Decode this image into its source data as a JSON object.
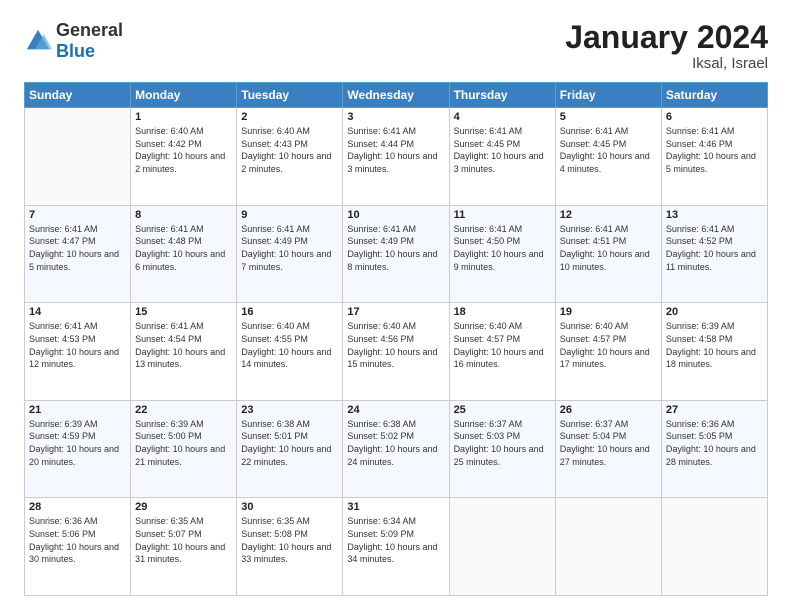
{
  "logo": {
    "general": "General",
    "blue": "Blue"
  },
  "header": {
    "month": "January 2024",
    "location": "Iksal, Israel"
  },
  "weekdays": [
    "Sunday",
    "Monday",
    "Tuesday",
    "Wednesday",
    "Thursday",
    "Friday",
    "Saturday"
  ],
  "weeks": [
    [
      {
        "day": "",
        "sunrise": "",
        "sunset": "",
        "daylight": ""
      },
      {
        "day": "1",
        "sunrise": "Sunrise: 6:40 AM",
        "sunset": "Sunset: 4:42 PM",
        "daylight": "Daylight: 10 hours and 2 minutes."
      },
      {
        "day": "2",
        "sunrise": "Sunrise: 6:40 AM",
        "sunset": "Sunset: 4:43 PM",
        "daylight": "Daylight: 10 hours and 2 minutes."
      },
      {
        "day": "3",
        "sunrise": "Sunrise: 6:41 AM",
        "sunset": "Sunset: 4:44 PM",
        "daylight": "Daylight: 10 hours and 3 minutes."
      },
      {
        "day": "4",
        "sunrise": "Sunrise: 6:41 AM",
        "sunset": "Sunset: 4:45 PM",
        "daylight": "Daylight: 10 hours and 3 minutes."
      },
      {
        "day": "5",
        "sunrise": "Sunrise: 6:41 AM",
        "sunset": "Sunset: 4:45 PM",
        "daylight": "Daylight: 10 hours and 4 minutes."
      },
      {
        "day": "6",
        "sunrise": "Sunrise: 6:41 AM",
        "sunset": "Sunset: 4:46 PM",
        "daylight": "Daylight: 10 hours and 5 minutes."
      }
    ],
    [
      {
        "day": "7",
        "sunrise": "Sunrise: 6:41 AM",
        "sunset": "Sunset: 4:47 PM",
        "daylight": "Daylight: 10 hours and 5 minutes."
      },
      {
        "day": "8",
        "sunrise": "Sunrise: 6:41 AM",
        "sunset": "Sunset: 4:48 PM",
        "daylight": "Daylight: 10 hours and 6 minutes."
      },
      {
        "day": "9",
        "sunrise": "Sunrise: 6:41 AM",
        "sunset": "Sunset: 4:49 PM",
        "daylight": "Daylight: 10 hours and 7 minutes."
      },
      {
        "day": "10",
        "sunrise": "Sunrise: 6:41 AM",
        "sunset": "Sunset: 4:49 PM",
        "daylight": "Daylight: 10 hours and 8 minutes."
      },
      {
        "day": "11",
        "sunrise": "Sunrise: 6:41 AM",
        "sunset": "Sunset: 4:50 PM",
        "daylight": "Daylight: 10 hours and 9 minutes."
      },
      {
        "day": "12",
        "sunrise": "Sunrise: 6:41 AM",
        "sunset": "Sunset: 4:51 PM",
        "daylight": "Daylight: 10 hours and 10 minutes."
      },
      {
        "day": "13",
        "sunrise": "Sunrise: 6:41 AM",
        "sunset": "Sunset: 4:52 PM",
        "daylight": "Daylight: 10 hours and 11 minutes."
      }
    ],
    [
      {
        "day": "14",
        "sunrise": "Sunrise: 6:41 AM",
        "sunset": "Sunset: 4:53 PM",
        "daylight": "Daylight: 10 hours and 12 minutes."
      },
      {
        "day": "15",
        "sunrise": "Sunrise: 6:41 AM",
        "sunset": "Sunset: 4:54 PM",
        "daylight": "Daylight: 10 hours and 13 minutes."
      },
      {
        "day": "16",
        "sunrise": "Sunrise: 6:40 AM",
        "sunset": "Sunset: 4:55 PM",
        "daylight": "Daylight: 10 hours and 14 minutes."
      },
      {
        "day": "17",
        "sunrise": "Sunrise: 6:40 AM",
        "sunset": "Sunset: 4:56 PM",
        "daylight": "Daylight: 10 hours and 15 minutes."
      },
      {
        "day": "18",
        "sunrise": "Sunrise: 6:40 AM",
        "sunset": "Sunset: 4:57 PM",
        "daylight": "Daylight: 10 hours and 16 minutes."
      },
      {
        "day": "19",
        "sunrise": "Sunrise: 6:40 AM",
        "sunset": "Sunset: 4:57 PM",
        "daylight": "Daylight: 10 hours and 17 minutes."
      },
      {
        "day": "20",
        "sunrise": "Sunrise: 6:39 AM",
        "sunset": "Sunset: 4:58 PM",
        "daylight": "Daylight: 10 hours and 18 minutes."
      }
    ],
    [
      {
        "day": "21",
        "sunrise": "Sunrise: 6:39 AM",
        "sunset": "Sunset: 4:59 PM",
        "daylight": "Daylight: 10 hours and 20 minutes."
      },
      {
        "day": "22",
        "sunrise": "Sunrise: 6:39 AM",
        "sunset": "Sunset: 5:00 PM",
        "daylight": "Daylight: 10 hours and 21 minutes."
      },
      {
        "day": "23",
        "sunrise": "Sunrise: 6:38 AM",
        "sunset": "Sunset: 5:01 PM",
        "daylight": "Daylight: 10 hours and 22 minutes."
      },
      {
        "day": "24",
        "sunrise": "Sunrise: 6:38 AM",
        "sunset": "Sunset: 5:02 PM",
        "daylight": "Daylight: 10 hours and 24 minutes."
      },
      {
        "day": "25",
        "sunrise": "Sunrise: 6:37 AM",
        "sunset": "Sunset: 5:03 PM",
        "daylight": "Daylight: 10 hours and 25 minutes."
      },
      {
        "day": "26",
        "sunrise": "Sunrise: 6:37 AM",
        "sunset": "Sunset: 5:04 PM",
        "daylight": "Daylight: 10 hours and 27 minutes."
      },
      {
        "day": "27",
        "sunrise": "Sunrise: 6:36 AM",
        "sunset": "Sunset: 5:05 PM",
        "daylight": "Daylight: 10 hours and 28 minutes."
      }
    ],
    [
      {
        "day": "28",
        "sunrise": "Sunrise: 6:36 AM",
        "sunset": "Sunset: 5:06 PM",
        "daylight": "Daylight: 10 hours and 30 minutes."
      },
      {
        "day": "29",
        "sunrise": "Sunrise: 6:35 AM",
        "sunset": "Sunset: 5:07 PM",
        "daylight": "Daylight: 10 hours and 31 minutes."
      },
      {
        "day": "30",
        "sunrise": "Sunrise: 6:35 AM",
        "sunset": "Sunset: 5:08 PM",
        "daylight": "Daylight: 10 hours and 33 minutes."
      },
      {
        "day": "31",
        "sunrise": "Sunrise: 6:34 AM",
        "sunset": "Sunset: 5:09 PM",
        "daylight": "Daylight: 10 hours and 34 minutes."
      },
      {
        "day": "",
        "sunrise": "",
        "sunset": "",
        "daylight": ""
      },
      {
        "day": "",
        "sunrise": "",
        "sunset": "",
        "daylight": ""
      },
      {
        "day": "",
        "sunrise": "",
        "sunset": "",
        "daylight": ""
      }
    ]
  ]
}
